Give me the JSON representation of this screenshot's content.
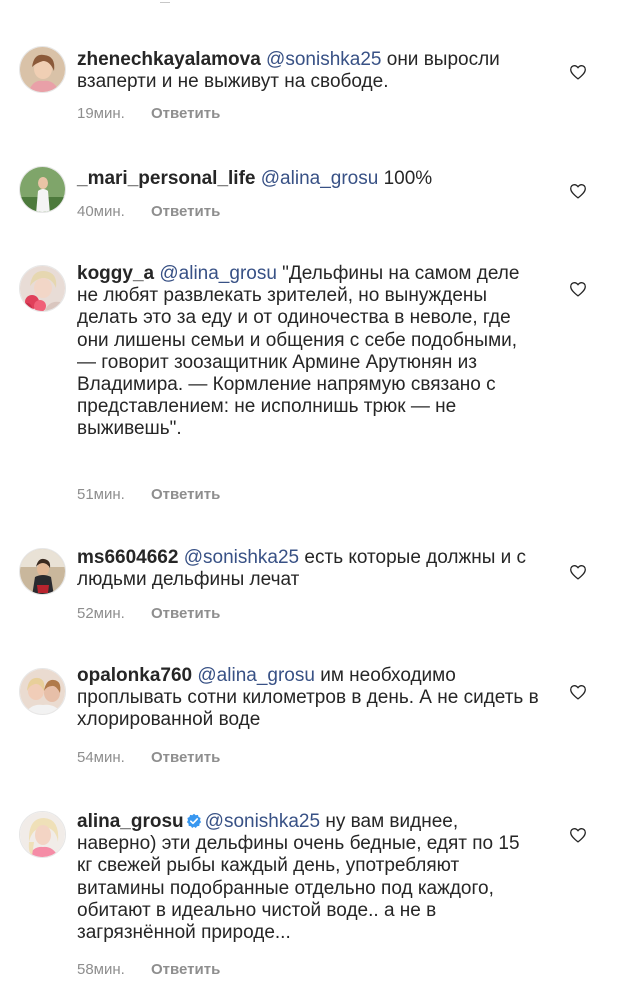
{
  "comments": [
    {
      "username": "zhenechkayalamova",
      "mention": "@sonishka25",
      "text": " они выросли взаперти и не выживут на свободе.",
      "time": "19мин.",
      "reply": "Ответить"
    },
    {
      "username": "_mari_personal_life",
      "mention": "@alina_grosu",
      "text": " 100%",
      "time": "40мин.",
      "reply": "Ответить"
    },
    {
      "username": "koggy_a",
      "mention": "@alina_grosu",
      "text": " \"Дельфины на самом деле не любят развлекать зрителей, но вынуждены делать это за еду и от одиночества в неволе, где они лишены семьи и общения с себе подобными, — говорит зоозащитник Армине Арутюнян из Владимира. — Кормление напрямую связано с представлением: не исполнишь трюк — не выживешь\".",
      "time": "51мин.",
      "reply": "Ответить"
    },
    {
      "username": "ms6604662",
      "mention": "@sonishka25",
      "text": " есть которые должны и с людьми  дельфины лечат",
      "time": "52мин.",
      "reply": "Ответить"
    },
    {
      "username": "opalonka760",
      "mention": "@alina_grosu",
      "text": " им необходимо проплывать сотни километров в день. А не сидеть в хлорированной воде",
      "time": "54мин.",
      "reply": "Ответить"
    },
    {
      "username": "alina_grosu",
      "mention": "@sonishka25",
      "text": " ну вам виднее, наверно) эти дельфины очень бедные, едят по 15 кг свежей рыбы каждый день, употребляют витамины подобранные отдельно под каждого, обитают в идеально чистой воде.. а не в загрязнённой природе...",
      "time": "58мин.",
      "reply": "Ответить"
    }
  ],
  "colors": {
    "text": "#262626",
    "mention": "#385185",
    "meta": "#8e8e8e",
    "verified": "#3897f0"
  },
  "icons": {
    "like": "heart-outline-icon",
    "verified": "verified-badge-icon"
  }
}
